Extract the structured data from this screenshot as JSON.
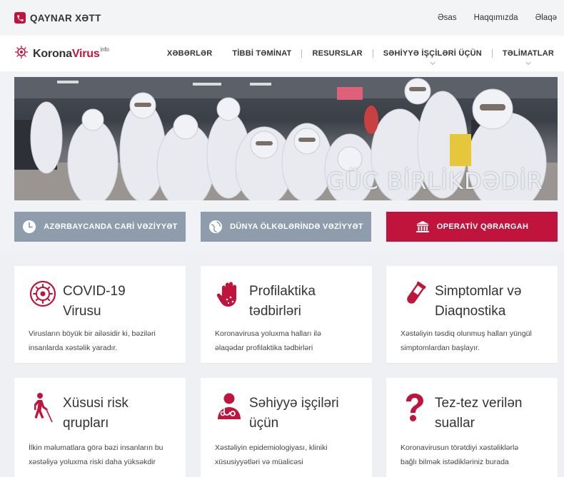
{
  "topbar": {
    "hotline_label": "QAYNAR XƏTT",
    "links": [
      "Əsas",
      "Haqqımızda",
      "Əlaqə"
    ]
  },
  "header": {
    "logo_part1": "Korona",
    "logo_part2": "Virus",
    "logo_sup": "info",
    "nav": [
      {
        "label": "XƏBƏRLƏR",
        "dropdown": false
      },
      {
        "label": "TİBBİ TƏMİNAT",
        "dropdown": false
      },
      {
        "label": "RESURSLAR",
        "dropdown": false
      },
      {
        "label": "SƏHİYYƏ İŞÇİLƏRİ ÜÇÜN",
        "dropdown": true
      },
      {
        "label": "TƏLİMATLAR",
        "dropdown": true
      }
    ]
  },
  "banner": {
    "slogan": "GÜC BİRLİKDƏDİR"
  },
  "actions": [
    {
      "label": "AZƏRBAYCANDA CARİ VƏZİYYƏT",
      "icon": "clock-icon",
      "style": "gray"
    },
    {
      "label": "DÜNYA ÖLKƏLƏRİNDƏ VƏZİYYƏT",
      "icon": "globe-icon",
      "style": "gray"
    },
    {
      "label": "OPERATİV QƏRARGAH",
      "icon": "government-building-icon",
      "style": "red"
    }
  ],
  "cards": [
    {
      "title_line1": "COVID-19",
      "title_line2": "Virusu",
      "desc_line1": "Virusların böyük bir ailəsidir ki, bəziləri",
      "desc_line2": "insanlarda xəstəlik yaradır.",
      "icon": "virus-icon"
    },
    {
      "title_line1": "Profilaktika",
      "title_line2": "tədbirləri",
      "desc_line1": "Koronavirusa yoluxma halları ilə",
      "desc_line2": "əlaqədar profilaktika tədbirləri",
      "icon": "hand-icon"
    },
    {
      "title_line1": "Simptomlar və",
      "title_line2": "Diaqnostika",
      "desc_line1": "Xəstəliyin təsdiq olunmuş halları yüngül",
      "desc_line2": "simptomlardan başlayır.",
      "icon": "test-tube-icon"
    },
    {
      "title_line1": "Xüsusi risk",
      "title_line2": "qrupları",
      "desc_line1": "İlkin məlumatlara görə bəzi insanların bu",
      "desc_line2": "xəstəliyə yoluxma riski daha yüksəkdir",
      "icon": "blind-person-icon"
    },
    {
      "title_line1": "Səhiyyə işçiləri",
      "title_line2": "üçün",
      "desc_line1": "Xəstəliyin epidemiologiyası, kliniki",
      "desc_line2": "xüsusiyyətləri və müalicəsi",
      "icon": "doctor-icon"
    },
    {
      "title_line1": "Tez-tez verilən",
      "title_line2": "suallar",
      "desc_line1": "Koronavirusun törətdiyi xəstəliklərlə",
      "desc_line2": "bağlı bilmək istədikləriniz burada",
      "icon": "question-mark-icon"
    }
  ],
  "colors": {
    "brand_red": "#c0143c",
    "button_gray": "#8e9cab"
  }
}
